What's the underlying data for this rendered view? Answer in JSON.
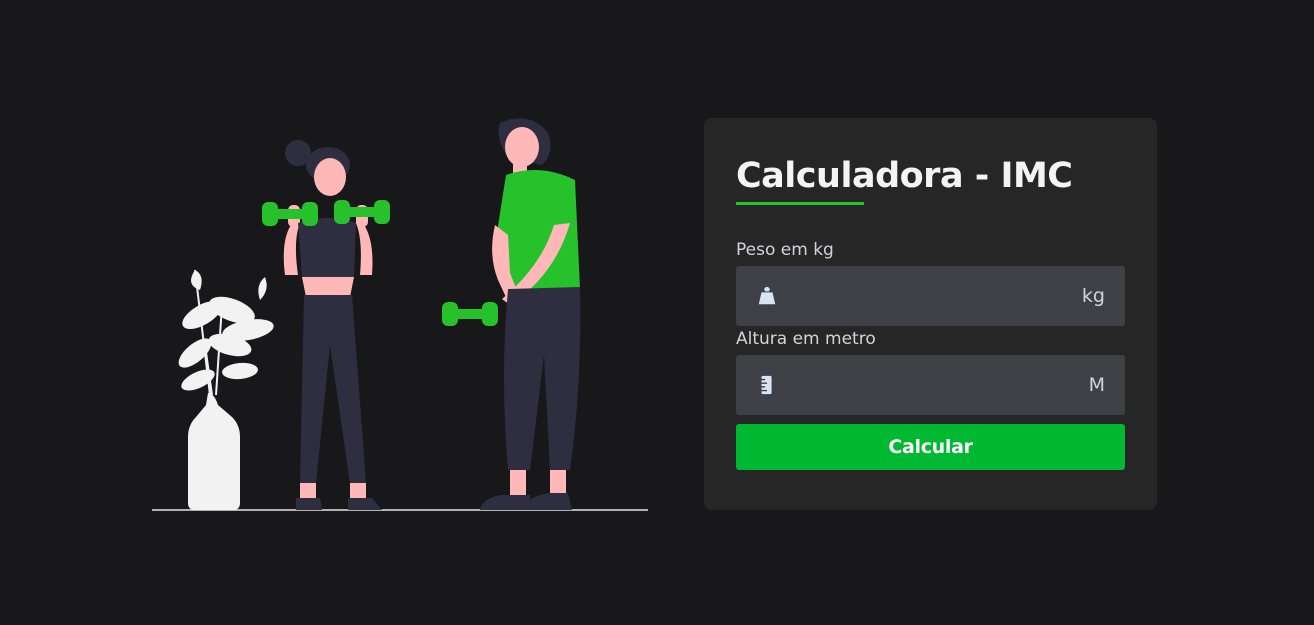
{
  "form": {
    "title": "Calculadora - IMC",
    "weight": {
      "label": "Peso em kg",
      "unit": "kg",
      "value": "",
      "icon": "weight-icon"
    },
    "height": {
      "label": "Altura em metro",
      "unit": "M",
      "value": "",
      "icon": "ruler-icon"
    },
    "submit_label": "Calcular"
  },
  "colors": {
    "background": "#18181a",
    "card": "#262626",
    "input": "#3f3f46",
    "accent": "#29c12b",
    "button": "#00b832"
  }
}
